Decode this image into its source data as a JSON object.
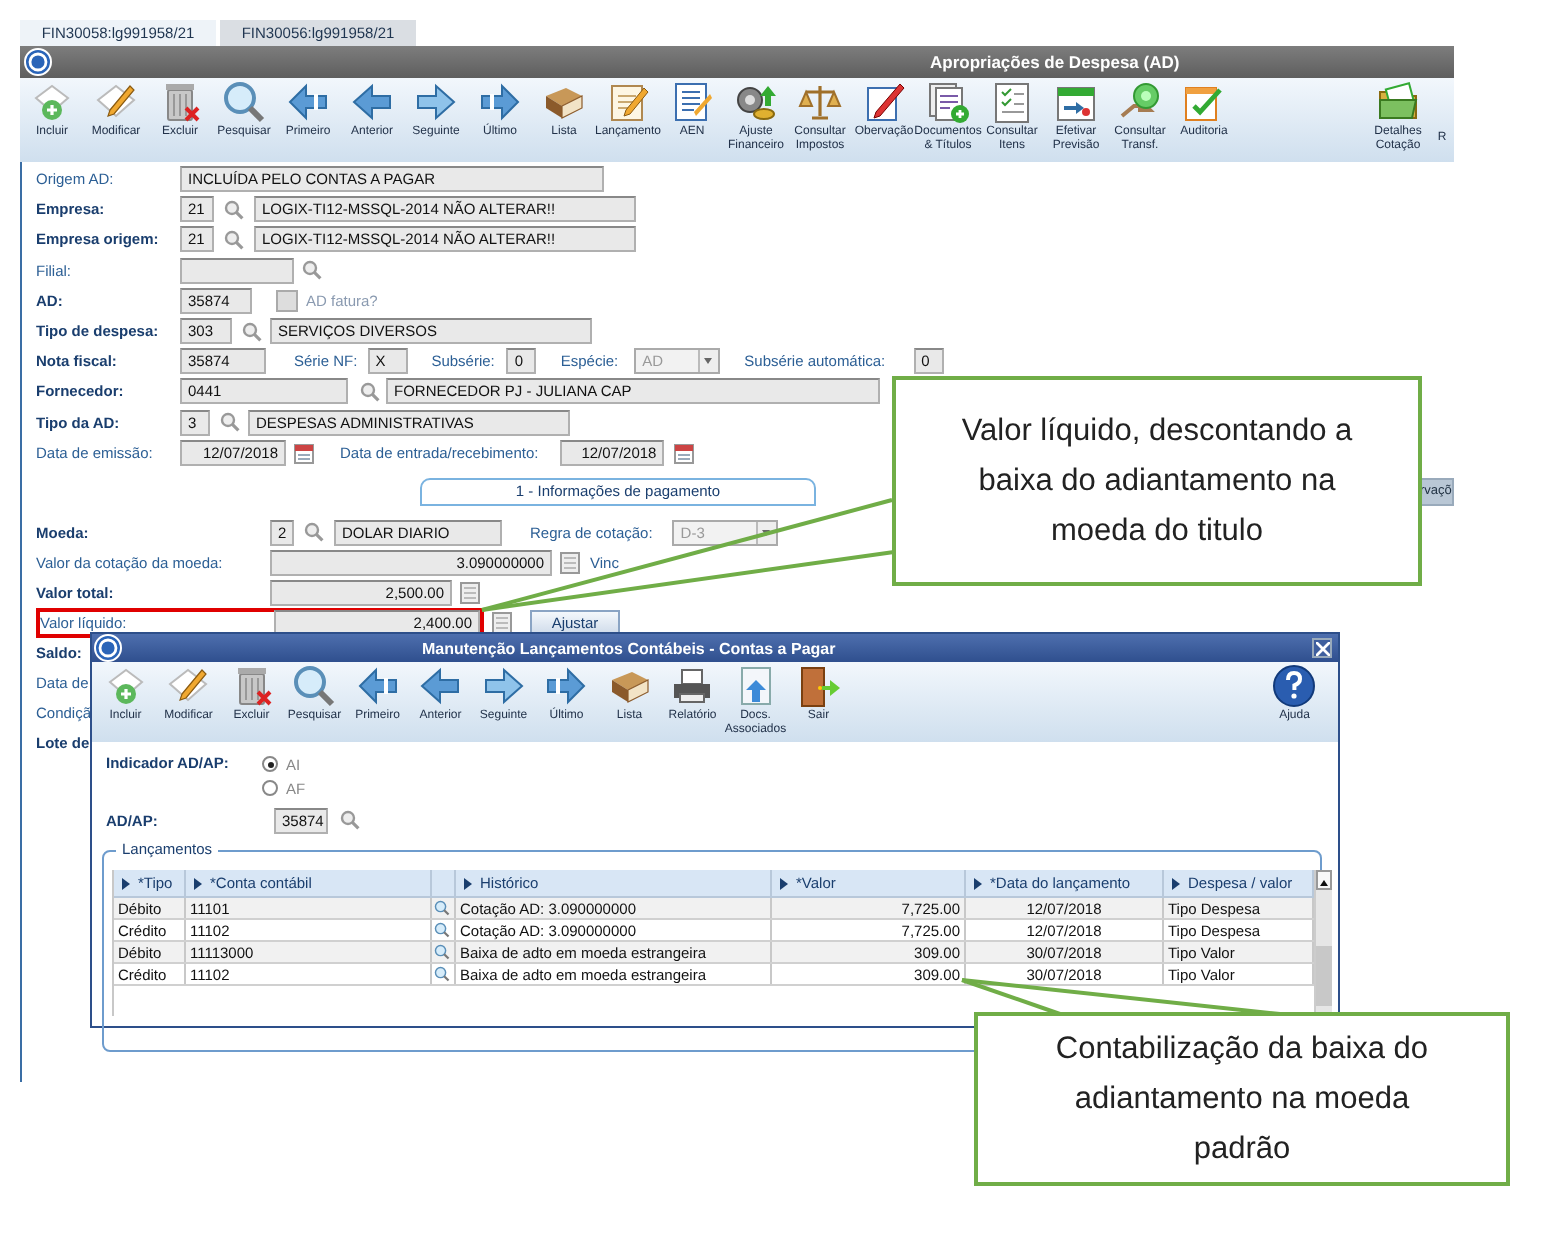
{
  "tabs": [
    {
      "label": "FIN30058:lg991958/21",
      "selected": true
    },
    {
      "label": "FIN30056:lg991958/21",
      "selected": false
    }
  ],
  "window": {
    "title": "Apropriações de Despesa (AD)"
  },
  "toolbar": [
    {
      "label": "Incluir"
    },
    {
      "label": "Modificar"
    },
    {
      "label": "Excluir"
    },
    {
      "label": "Pesquisar"
    },
    {
      "label": "Primeiro"
    },
    {
      "label": "Anterior"
    },
    {
      "label": "Seguinte"
    },
    {
      "label": "Último"
    },
    {
      "label": "Lista"
    },
    {
      "label": "Lançamento"
    },
    {
      "label": "AEN"
    },
    {
      "label": "Ajuste\nFinanceiro"
    },
    {
      "label": "Consultar\nImpostos"
    },
    {
      "label": "Obervação"
    },
    {
      "label": "Documentos\n& Títulos"
    },
    {
      "label": "Consultar\nItens"
    },
    {
      "label": "Efetivar\nPrevisão"
    },
    {
      "label": "Consultar\nTransf."
    },
    {
      "label": "Auditoria"
    },
    {
      "label": "Detalhes\nCotação"
    },
    {
      "label": "R"
    }
  ],
  "form": {
    "rows": [
      {
        "label": "Origem AD:",
        "bold": false,
        "items": [
          {
            "kind": "input",
            "value": "INCLUÍDA PELO CONTAS A PAGAR"
          }
        ]
      },
      {
        "label": "Empresa:",
        "bold": true,
        "items": [
          {
            "kind": "input",
            "value": "21"
          },
          {
            "kind": "lookup"
          },
          {
            "kind": "input",
            "value": "LOGIX-TI12-MSSQL-2014 NÃO ALTERAR!!"
          }
        ]
      },
      {
        "label": "Empresa origem:",
        "bold": true,
        "items": [
          {
            "kind": "input",
            "value": "21"
          },
          {
            "kind": "lookup"
          },
          {
            "kind": "input",
            "value": "LOGIX-TI12-MSSQL-2014 NÃO ALTERAR!!"
          }
        ]
      },
      {
        "label": "Filial:",
        "bold": false,
        "items": [
          {
            "kind": "input"
          },
          {
            "kind": "lookup"
          }
        ]
      },
      {
        "label": "AD:",
        "bold": true,
        "items": [
          {
            "kind": "input",
            "value": "35874"
          },
          {
            "kind": "check",
            "label": "AD fatura?",
            "checked": false,
            "disabled": true
          }
        ]
      },
      {
        "label": "Tipo de despesa:",
        "bold": true,
        "items": [
          {
            "kind": "input",
            "value": "303"
          },
          {
            "kind": "lookup"
          },
          {
            "kind": "input",
            "value": "SERVIÇOS DIVERSOS"
          }
        ]
      },
      {
        "label": "Nota fiscal:",
        "bold": true,
        "items": [
          {
            "kind": "input",
            "value": "35874"
          },
          {
            "kind": "text",
            "text": "Série NF:"
          },
          {
            "kind": "input",
            "value": "X"
          },
          {
            "kind": "text",
            "text": "Subsérie:"
          },
          {
            "kind": "input",
            "value": "0"
          },
          {
            "kind": "text",
            "text": "Espécie:"
          },
          {
            "kind": "combo",
            "value": "AD",
            "disabled": true
          },
          {
            "kind": "text",
            "text": "Subsérie automática:"
          },
          {
            "kind": "input",
            "value": "0"
          }
        ]
      },
      {
        "label": "Fornecedor:",
        "bold": true,
        "items": [
          {
            "kind": "input",
            "value": "0441"
          },
          {
            "kind": "lookup"
          },
          {
            "kind": "input",
            "value": "FORNECEDOR PJ - JULIANA CAP"
          }
        ]
      },
      {
        "label": "Tipo da AD:",
        "bold": true,
        "items": [
          {
            "kind": "input",
            "value": "3"
          },
          {
            "kind": "lookup"
          },
          {
            "kind": "input",
            "value": "DESPESAS ADMINISTRATIVAS"
          }
        ]
      },
      {
        "label": "Data de emissão:",
        "bold": false,
        "items": [
          {
            "kind": "number",
            "value": "12/07/2018"
          },
          {
            "kind": "calendar"
          },
          {
            "kind": "text",
            "text": "Data de entrada/recebimento:"
          },
          {
            "kind": "number",
            "value": "12/07/2018"
          },
          {
            "kind": "calendar"
          }
        ]
      }
    ]
  },
  "section_tabs": [
    {
      "label": "1 - Informações de pagamento",
      "selected": true
    },
    {
      "label": "rvaçõ",
      "selected": false
    }
  ],
  "payment": {
    "rows": [
      {
        "label": "Moeda:",
        "bold": true,
        "highlighted": false,
        "items": [
          {
            "kind": "input",
            "value": "2"
          },
          {
            "kind": "lookup"
          },
          {
            "kind": "input",
            "value": "DOLAR DIARIO"
          },
          {
            "kind": "text",
            "text": "Regra de cotação:"
          },
          {
            "kind": "combo",
            "value": "D-3",
            "disabled": true
          }
        ]
      },
      {
        "label": "Valor da cotação da moeda:",
        "bold": false,
        "highlighted": false,
        "items": [
          {
            "kind": "number",
            "value": "3.090000000"
          },
          {
            "kind": "calc"
          },
          {
            "kind": "text",
            "text": "Vinc"
          }
        ]
      },
      {
        "label": "Valor total:",
        "bold": true,
        "highlighted": false,
        "items": [
          {
            "kind": "number",
            "value": "2,500.00"
          },
          {
            "kind": "calc"
          }
        ]
      },
      {
        "label": "Valor líquido:",
        "bold": false,
        "highlighted": true,
        "items": [
          {
            "kind": "number",
            "value": "2,400.00"
          },
          {
            "kind": "calc"
          },
          {
            "kind": "button",
            "label": "Ajustar"
          }
        ]
      },
      {
        "label": "Saldo:",
        "bold": true,
        "items": []
      },
      {
        "label": "Data de",
        "bold": false,
        "items": []
      },
      {
        "label": "Condiçã",
        "bold": false,
        "items": []
      },
      {
        "label": "Lote de",
        "bold": true,
        "items": []
      }
    ]
  },
  "dialog": {
    "title": "Manutenção Lançamentos Contábeis - Contas a Pagar",
    "toolbar": [
      {
        "label": "Incluir"
      },
      {
        "label": "Modificar"
      },
      {
        "label": "Excluir"
      },
      {
        "label": "Pesquisar"
      },
      {
        "label": "Primeiro"
      },
      {
        "label": "Anterior"
      },
      {
        "label": "Seguinte"
      },
      {
        "label": "Último"
      },
      {
        "label": "Lista"
      },
      {
        "label": "Relatório"
      },
      {
        "label": "Docs.\nAssociados"
      },
      {
        "label": "Sair"
      }
    ],
    "help": {
      "label": "Ajuda"
    },
    "indicator": {
      "label": "Indicador AD/AP:",
      "options": [
        {
          "label": "AI",
          "selected": true
        },
        {
          "label": "AF",
          "selected": false
        }
      ]
    },
    "ad_ap": {
      "label": "AD/AP:",
      "value": "35874"
    },
    "group_title": "Lançamentos",
    "table": {
      "columns": [
        "*Tipo",
        "*Conta contábil",
        "Histórico",
        "*Valor",
        "*Data do lançamento",
        "Despesa / valor"
      ],
      "rows": [
        [
          "Débito",
          "11101",
          "Cotação AD: 3.090000000",
          "7,725.00",
          "12/07/2018",
          "Tipo Despesa"
        ],
        [
          "Crédito",
          "11102",
          "Cotação AD: 3.090000000",
          "7,725.00",
          "12/07/2018",
          "Tipo Despesa"
        ],
        [
          "Débito",
          "11113000",
          "Baixa de adto em moeda estrangeira",
          "309.00",
          "30/07/2018",
          "Tipo Valor"
        ],
        [
          "Crédito",
          "11102",
          "Baixa de adto em moeda estrangeira",
          "309.00",
          "30/07/2018",
          "Tipo Valor"
        ]
      ]
    }
  },
  "callouts": [
    {
      "text": "Valor líquido, descontando a\nbaixa do adiantamento na\nmoeda do titulo"
    },
    {
      "text": "Contabilização da baixa do\nadiantamento na moeda\npadrão"
    }
  ]
}
